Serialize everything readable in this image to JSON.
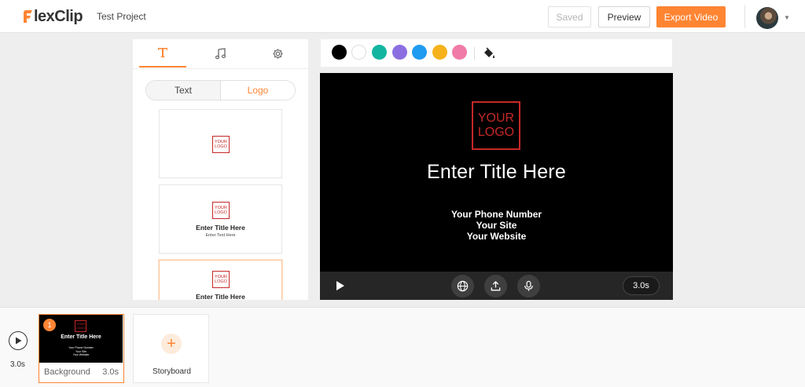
{
  "app": {
    "brand_first": "F",
    "brand_rest": "lexClip",
    "project_name": "Test Project"
  },
  "header": {
    "saved_label": "Saved",
    "preview_label": "Preview",
    "export_label": "Export Video",
    "accent_color": "#ff8533"
  },
  "left_panel": {
    "tabs": [
      {
        "icon": "text-icon",
        "active": true
      },
      {
        "icon": "music-note-icon",
        "active": false
      },
      {
        "icon": "gear-icon",
        "active": false
      }
    ],
    "segment": {
      "text_label": "Text",
      "logo_label": "Logo",
      "selected": "Logo"
    },
    "templates": [
      {
        "logo": "YOUR LOGO"
      },
      {
        "logo": "YOUR LOGO",
        "title": "Enter Title Here",
        "subtitle": "Enter Text Here"
      },
      {
        "logo": "YOUR LOGO",
        "title": "Enter Title Here"
      }
    ]
  },
  "color_bar": {
    "swatches": [
      "#000000",
      "#ffffff",
      "#12b5a0",
      "#8b6fe0",
      "#1f9bf0",
      "#f5b21b",
      "#f07aa8"
    ],
    "fill_icon": "paint-bucket-icon"
  },
  "preview": {
    "logo_line1": "YOUR",
    "logo_line2": "LOGO",
    "title": "Enter Title Here",
    "lines": [
      "Your Phone Number",
      "Your Site",
      "Your Website"
    ],
    "duration": "3.0s"
  },
  "timeline": {
    "total_time": "3.0s",
    "clips": [
      {
        "index": "1",
        "label": "Background",
        "duration": "3.0s",
        "thumb_logo": "YOUR LOGO",
        "thumb_title": "Enter Title Here",
        "thumb_lines": [
          "Your Phone Number",
          "Your Site",
          "Your Website"
        ]
      }
    ],
    "add_label": "Storyboard"
  }
}
